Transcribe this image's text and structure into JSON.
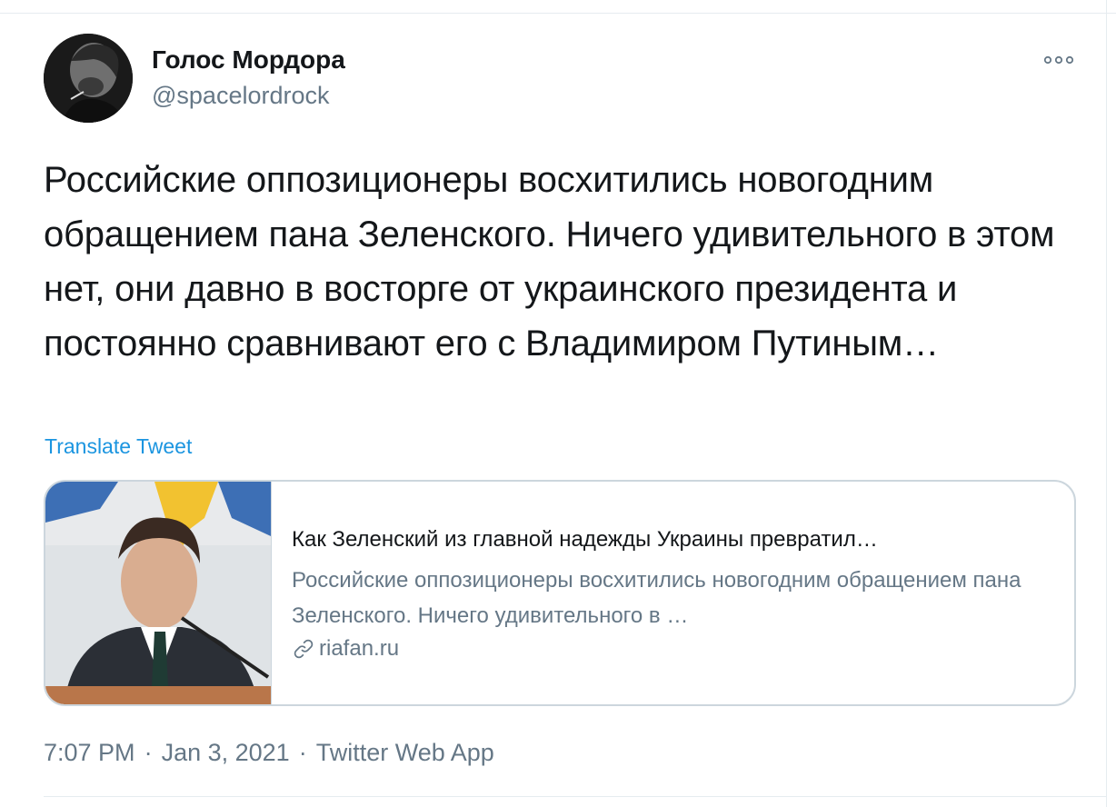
{
  "author": {
    "name": "Голос Мордора",
    "handle": "@spacelordrock"
  },
  "more_icon": "more-options-icon",
  "tweet": {
    "text": "Российские оппозиционеры восхитились новогодним обращением пана Зеленского. Ничего удивительного в этом нет, они давно в восторге от украинского президента и постоянно сравнивают его с Владимиром Путиным…",
    "translate_label": "Translate Tweet"
  },
  "card": {
    "title": "Как Зеленский из главной надежды Украины превратил…",
    "description": "Российские оппозиционеры восхитились новогодним обращением пана Зеленского. Ничего удивительного в …",
    "domain": "riafan.ru",
    "domain_icon": "link-icon"
  },
  "meta": {
    "time": "7:07 PM",
    "separator": "·",
    "date": "Jan 3, 2021",
    "source": "Twitter Web App"
  },
  "colors": {
    "text_primary": "#14171a",
    "text_secondary": "#657786",
    "link": "#1b95e0",
    "border": "#ccd6dd"
  }
}
